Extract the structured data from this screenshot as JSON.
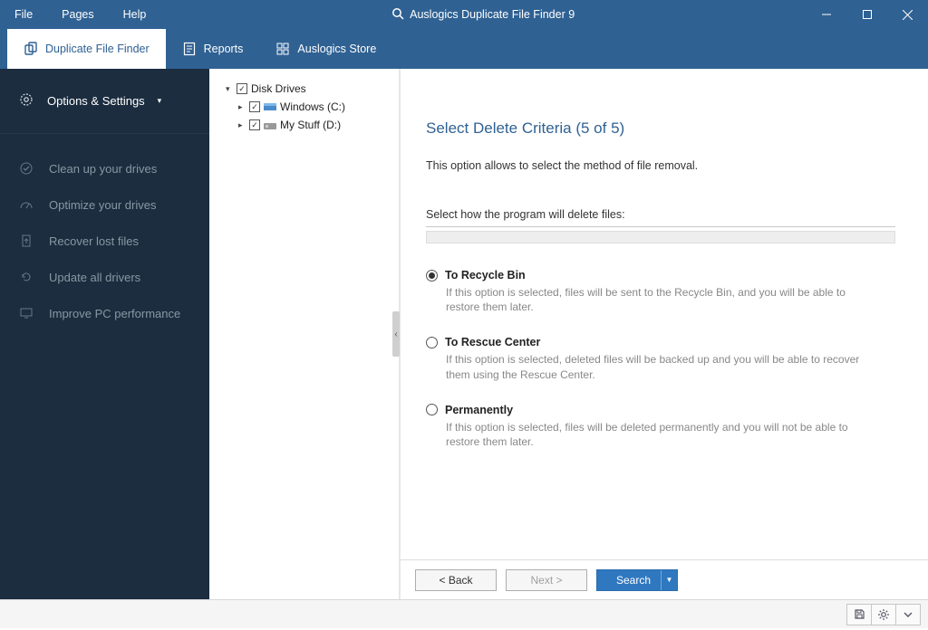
{
  "titlebar": {
    "menu": [
      "File",
      "Pages",
      "Help"
    ],
    "app_title": "Auslogics Duplicate File Finder 9"
  },
  "tabs": [
    {
      "label": "Duplicate File Finder",
      "active": true
    },
    {
      "label": "Reports",
      "active": false
    },
    {
      "label": "Auslogics Store",
      "active": false
    }
  ],
  "sidebar": {
    "options_label": "Options & Settings",
    "items": [
      {
        "label": "Clean up your drives"
      },
      {
        "label": "Optimize your drives"
      },
      {
        "label": "Recover lost files"
      },
      {
        "label": "Update all drivers"
      },
      {
        "label": "Improve PC performance"
      }
    ]
  },
  "tree": {
    "root": "Disk Drives",
    "drives": [
      {
        "label": "Windows (C:)"
      },
      {
        "label": "My Stuff (D:)"
      }
    ]
  },
  "content": {
    "heading": "Select Delete Criteria (5 of 5)",
    "subtext": "This option allows to select the method of file removal.",
    "section_label": "Select how the program will delete files:",
    "options": [
      {
        "title": "To Recycle Bin",
        "desc": "If this option is selected, files will be sent to the Recycle Bin, and you will be able to restore them later.",
        "selected": true
      },
      {
        "title": "To Rescue Center",
        "desc": "If this option is selected, deleted files will be backed up and you will be able to recover them using the Rescue Center.",
        "selected": false
      },
      {
        "title": "Permanently",
        "desc": "If this option is selected, files will be deleted permanently and you will not be able to restore them later.",
        "selected": false
      }
    ],
    "buttons": {
      "back": "< Back",
      "next": "Next >",
      "search": "Search"
    }
  }
}
